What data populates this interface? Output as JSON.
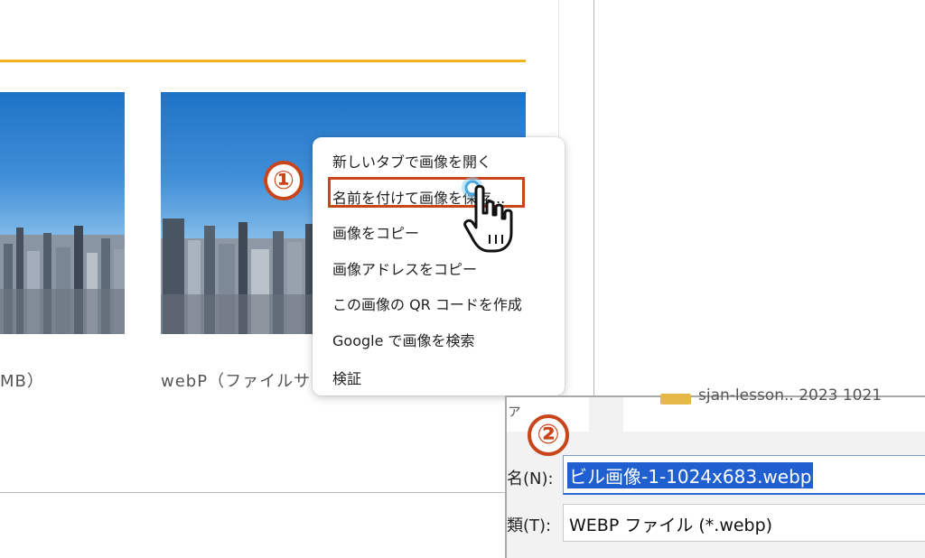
{
  "page": {
    "caption_left": "MB）",
    "caption_right": "webP（ファイルサ"
  },
  "context_menu": {
    "items": [
      "新しいタブで画像を開く",
      "名前を付けて画像を保存...",
      "画像をコピー",
      "画像アドレスをコピー",
      "この画像の QR コードを作成",
      "Google で画像を検索",
      "検証"
    ],
    "highlighted_item": "名前を付けて画像を保存..."
  },
  "annotations": {
    "step_one": "①",
    "step_two": "②",
    "accent_color": "#c9461c",
    "cursor_icon": "hand-pointer-icon"
  },
  "save_dialog": {
    "strip_text": "ァ",
    "strip_path": "sjan-lesson.. 2023 1021",
    "filename_label": "名(N):",
    "filename_value": "ビル画像-1-1024x683.webp",
    "filetype_label": "類(T):",
    "filetype_value": "WEBP ファイル (*.webp)"
  },
  "colors": {
    "heading_rule": "#f2b21e",
    "selection": "#1f5fcf"
  }
}
